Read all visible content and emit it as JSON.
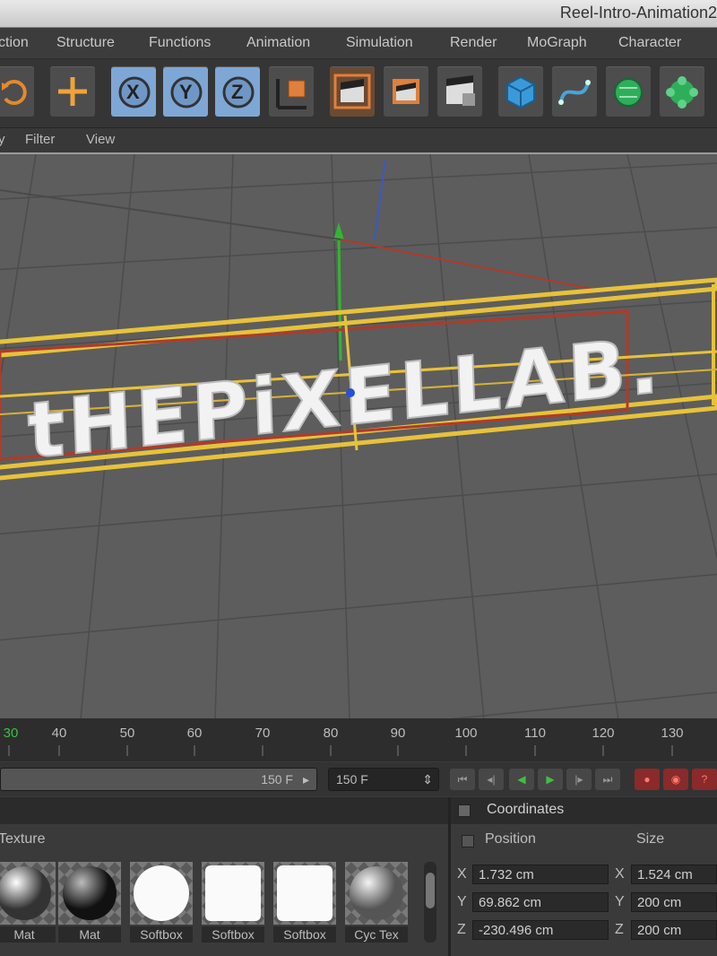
{
  "window": {
    "title": "Reel-Intro-Animation2"
  },
  "menubar": {
    "items": [
      "ction",
      "Structure",
      "Functions",
      "Animation",
      "Simulation",
      "Render",
      "MoGraph",
      "Character"
    ]
  },
  "toolbar": {
    "axis_x": "X",
    "axis_y": "Y",
    "axis_z": "Z",
    "icons": [
      "rotate-icon",
      "move-icon",
      "x-axis-icon",
      "y-axis-icon",
      "z-axis-icon",
      "coordinate-system-icon",
      "render-view-icon",
      "render-picture-viewer-icon",
      "render-settings-icon",
      "cube-icon",
      "spline-icon",
      "nurbs-icon",
      "array-icon"
    ]
  },
  "viewmenu": {
    "items": [
      "y",
      "Filter",
      "View"
    ]
  },
  "viewport": {
    "scene_text": "tHEPiXELLAB."
  },
  "timeline": {
    "ticks": [
      "30",
      "40",
      "50",
      "60",
      "70",
      "80",
      "90",
      "100",
      "110",
      "120",
      "130"
    ]
  },
  "transport": {
    "end_frame": "150 F",
    "current_frame": "150 F"
  },
  "materials": {
    "header": "Texture",
    "items": [
      {
        "name": "Mat",
        "look": "sphere-light"
      },
      {
        "name": "Mat",
        "look": "sphere-dark"
      },
      {
        "name": "Softbox",
        "look": "circle-white"
      },
      {
        "name": "Softbox",
        "look": "square-white"
      },
      {
        "name": "Softbox",
        "look": "square-white"
      },
      {
        "name": "Cyc Tex",
        "look": "sphere-gray"
      }
    ]
  },
  "coordinates": {
    "title": "Coordinates",
    "position_header": "Position",
    "size_header": "Size",
    "rows": [
      {
        "axis": "X",
        "position": "1.732 cm",
        "size_axis": "X",
        "size": "1.524 cm"
      },
      {
        "axis": "Y",
        "position": "69.862 cm",
        "size_axis": "Y",
        "size": "200 cm"
      },
      {
        "axis": "Z",
        "position": "-230.496 cm",
        "size_axis": "Z",
        "size": "200 cm"
      }
    ]
  },
  "colors": {
    "accent": "#7ea7d6",
    "orange": "#e0803a",
    "selection_yellow": "#e7c23a",
    "play_green": "#3fbf3f"
  }
}
